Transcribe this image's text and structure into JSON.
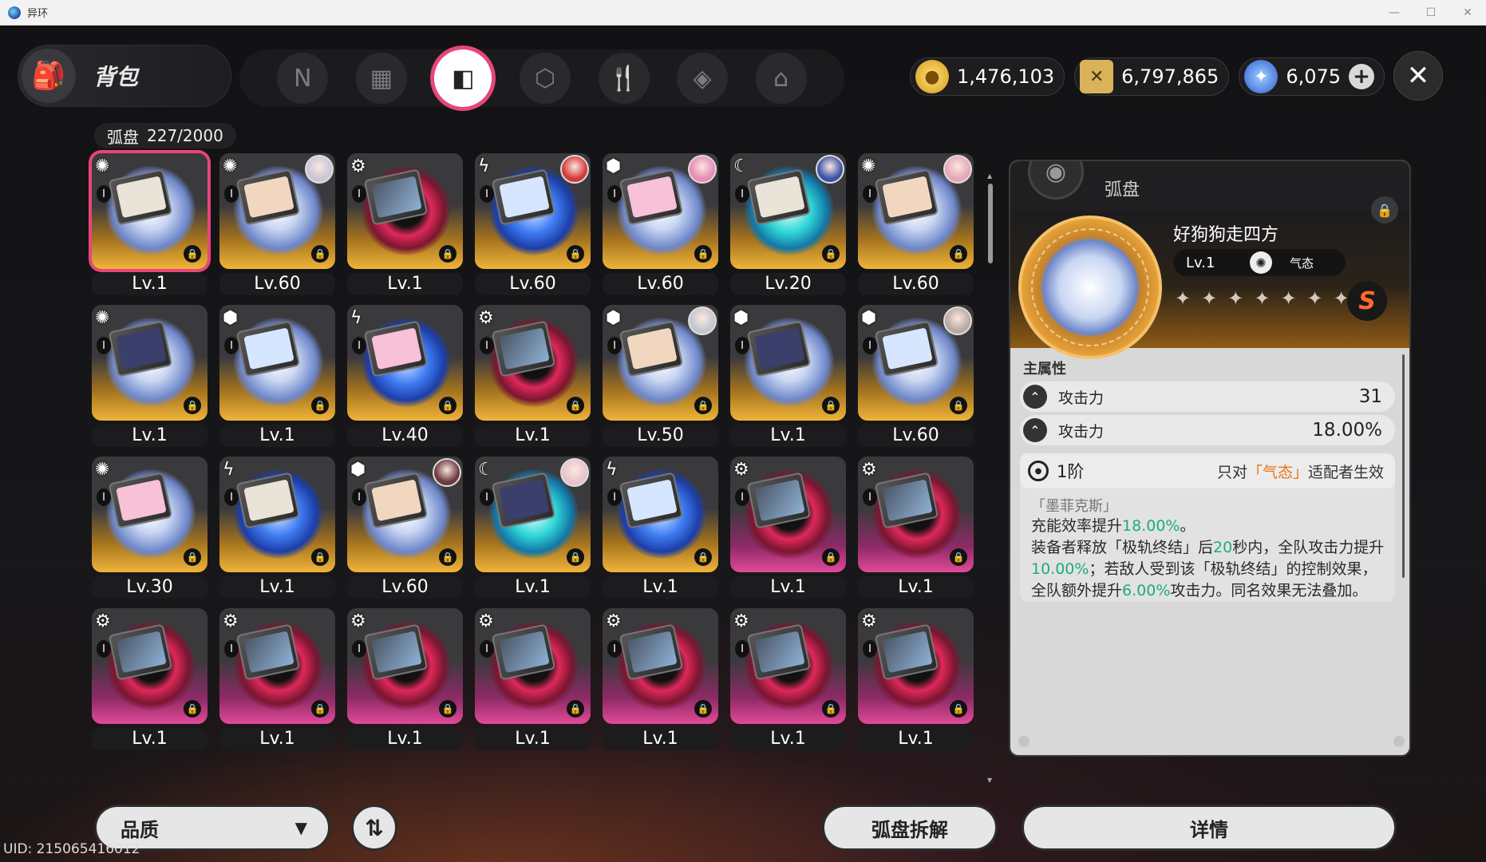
{
  "window": {
    "title": "异环"
  },
  "header": {
    "backpack_title": "背包",
    "tabs": [
      {
        "icon": "n-logo-icon"
      },
      {
        "icon": "gameboy-icon"
      },
      {
        "icon": "disc-icon",
        "active": true
      },
      {
        "icon": "cube-icon"
      },
      {
        "icon": "fork-knife-icon"
      },
      {
        "icon": "box-icon"
      },
      {
        "icon": "home-icon"
      }
    ],
    "currencies": [
      {
        "name": "gold-coin",
        "value": "1,476,103"
      },
      {
        "name": "ticket",
        "value": "6,797,865"
      },
      {
        "name": "crystal",
        "value": "6,075"
      }
    ]
  },
  "inventory": {
    "label": "弧盘",
    "count": "227/2000",
    "items": [
      {
        "lv": "Lv.1",
        "bg": "gold",
        "art": "white",
        "type": "spin",
        "avatar": null,
        "selected": true
      },
      {
        "lv": "Lv.60",
        "bg": "gold",
        "art": "white",
        "type": "spin",
        "avatar": "#c9c6d6"
      },
      {
        "lv": "Lv.1",
        "bg": "gold",
        "art": "red",
        "type": "gear",
        "avatar": null
      },
      {
        "lv": "Lv.60",
        "bg": "gold",
        "art": "blue",
        "type": "bolt",
        "avatar": "#d23a3a"
      },
      {
        "lv": "Lv.60",
        "bg": "gold",
        "art": "white",
        "type": "cube",
        "avatar": "#e88bb6"
      },
      {
        "lv": "Lv.20",
        "bg": "gold",
        "art": "cyan",
        "type": "moon",
        "avatar": "#3d53a8"
      },
      {
        "lv": "Lv.60",
        "bg": "gold",
        "art": "white",
        "type": "spin",
        "avatar": "#e6a7b8"
      },
      {
        "lv": "Lv.1",
        "bg": "gold",
        "art": "white",
        "type": "spin",
        "avatar": null
      },
      {
        "lv": "Lv.1",
        "bg": "gold",
        "art": "white",
        "type": "cube",
        "avatar": null
      },
      {
        "lv": "Lv.40",
        "bg": "gold",
        "art": "blue",
        "type": "bolt",
        "avatar": null
      },
      {
        "lv": "Lv.1",
        "bg": "gold",
        "art": "red",
        "type": "gear",
        "avatar": null
      },
      {
        "lv": "Lv.50",
        "bg": "gold",
        "art": "white",
        "type": "cube",
        "avatar": "#c4c6cf"
      },
      {
        "lv": "Lv.1",
        "bg": "gold",
        "art": "white",
        "type": "cube",
        "avatar": null
      },
      {
        "lv": "Lv.60",
        "bg": "gold",
        "art": "white",
        "type": "cube",
        "avatar": "#b9a8a2"
      },
      {
        "lv": "Lv.30",
        "bg": "gold",
        "art": "white",
        "type": "spin",
        "avatar": null
      },
      {
        "lv": "Lv.1",
        "bg": "gold",
        "art": "blue",
        "type": "bolt",
        "avatar": null
      },
      {
        "lv": "Lv.60",
        "bg": "gold",
        "art": "white",
        "type": "cube",
        "avatar": "#6b3a3f"
      },
      {
        "lv": "Lv.1",
        "bg": "gold",
        "art": "cyan",
        "type": "moon",
        "avatar": "#e9c3c9"
      },
      {
        "lv": "Lv.1",
        "bg": "gold",
        "art": "blue",
        "type": "bolt",
        "avatar": null
      },
      {
        "lv": "Lv.1",
        "bg": "pink",
        "art": "red",
        "type": "gear",
        "avatar": null
      },
      {
        "lv": "Lv.1",
        "bg": "pink",
        "art": "red",
        "type": "gear",
        "avatar": null
      },
      {
        "lv": "Lv.1",
        "bg": "pink",
        "art": "red",
        "type": "gear",
        "avatar": null
      },
      {
        "lv": "Lv.1",
        "bg": "pink",
        "art": "red",
        "type": "gear",
        "avatar": null
      },
      {
        "lv": "Lv.1",
        "bg": "pink",
        "art": "red",
        "type": "gear",
        "avatar": null
      },
      {
        "lv": "Lv.1",
        "bg": "pink",
        "art": "red",
        "type": "gear",
        "avatar": null
      },
      {
        "lv": "Lv.1",
        "bg": "pink",
        "art": "red",
        "type": "gear",
        "avatar": null
      },
      {
        "lv": "Lv.1",
        "bg": "pink",
        "art": "red",
        "type": "gear",
        "avatar": null
      },
      {
        "lv": "Lv.1",
        "bg": "pink",
        "art": "red",
        "type": "gear",
        "avatar": null
      }
    ]
  },
  "detail": {
    "category": "弧盘",
    "name": "好狗狗走四方",
    "level": "Lv.1",
    "attribute": "气态",
    "rank": "S",
    "stars": 7,
    "main_attr_label": "主属性",
    "stats": [
      {
        "name": "攻击力",
        "value": "31"
      },
      {
        "name": "攻击力",
        "value": "18.00%"
      }
    ],
    "effect": {
      "tier": "1阶",
      "apply_prefix": "只对",
      "apply_attr": "「气态」",
      "apply_suffix": "适配者生效",
      "title": "「墨菲克斯」",
      "line1_a": "充能效率提升",
      "line1_b": "18.00%",
      "line1_c": "。",
      "line2_a": "装备者释放「极轨终结」后",
      "line2_b": "20",
      "line2_c": "秒内，全队攻击力提升",
      "line2_d": "10.00%",
      "line2_e": "；若敌人受到该「极轨终结」的控制效果，全队额外提升",
      "line2_f": "6.00%",
      "line2_g": "攻击力。同名效果无法叠加。"
    }
  },
  "footer": {
    "quality_label": "品质",
    "dismantle_label": "弧盘拆解",
    "details_label": "详情",
    "uid": "UID: 215065416012"
  }
}
